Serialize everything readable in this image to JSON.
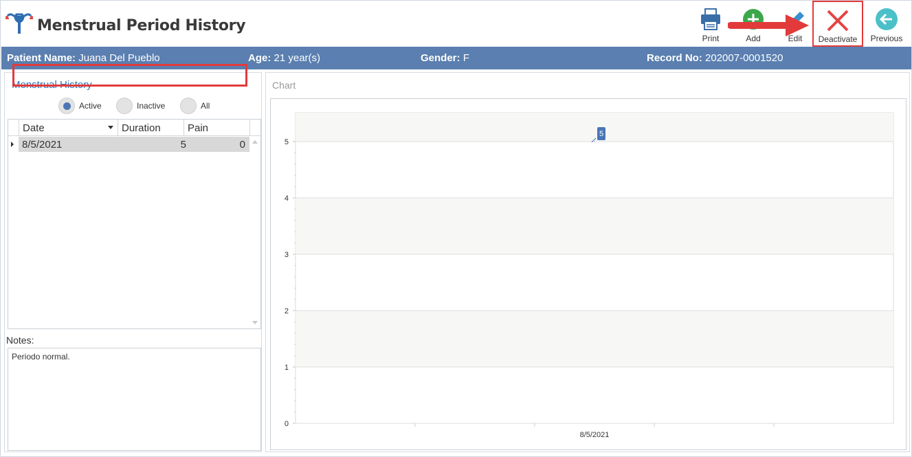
{
  "header": {
    "title": "Menstrual Period History",
    "toolbar": {
      "print_label": "Print",
      "add_label": "Add",
      "edit_label": "Edit",
      "deactivate_label": "Deactivate",
      "previous_label": "Previous"
    }
  },
  "patient": {
    "name_label": "Patient Name:",
    "name": "Juana Del Pueblo",
    "age_label": "Age:",
    "age": "21 year(s)",
    "gender_label": "Gender:",
    "gender": "F",
    "record_label": "Record No:",
    "record": "202007-0001520"
  },
  "history": {
    "title": "Menstrual History",
    "filters": {
      "active": "Active",
      "inactive": "Inactive",
      "all": "All",
      "selected": "Active"
    },
    "columns": {
      "date": "Date",
      "duration": "Duration",
      "pain": "Pain"
    },
    "rows": [
      {
        "date": "8/5/2021",
        "duration": "5",
        "pain": "0"
      }
    ]
  },
  "notes": {
    "label": "Notes:",
    "text": "Periodo normal."
  },
  "chart": {
    "title": "Chart"
  },
  "chart_data": {
    "type": "line",
    "categories": [
      "8/5/2021"
    ],
    "series": [
      {
        "values": [
          5
        ]
      }
    ],
    "data_labels": [
      "5"
    ],
    "ylim": [
      0,
      5
    ],
    "yticks": [
      "0",
      "1",
      "2",
      "3",
      "4",
      "5"
    ],
    "grid": true,
    "series_color": "#4a76b6"
  },
  "colors": {
    "accent": "#5a7fb0",
    "highlight_border": "#e23a3a",
    "link": "#2e6fb5"
  }
}
